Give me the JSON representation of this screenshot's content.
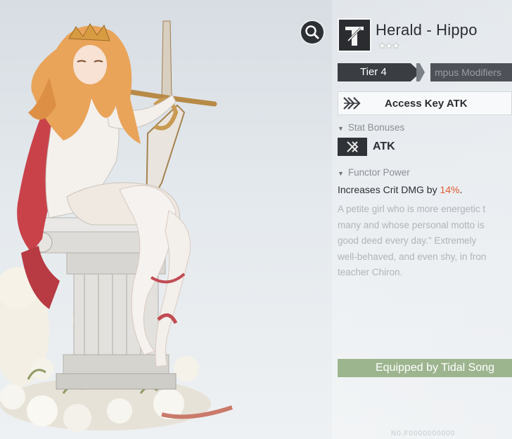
{
  "card": {
    "name": "Herald - Hippo",
    "stars": "★★★",
    "tier": "Tier 4",
    "modifiers_tab": "mpus Modifiers",
    "access_key": "Access Key ATK",
    "stat_heading": "Stat Bonuses",
    "stat_label": "ATK",
    "functor_heading": "Functor Power",
    "power_text": "Increases Crit DMG by ",
    "power_value": "14%",
    "power_suffix": ".",
    "description": [
      "A petite girl who is more energetic t",
      "many and whose personal motto is",
      "good deed every day.\" Extremely",
      "well-behaved, and even shy, in fron",
      "teacher Chiron."
    ],
    "equipped": "Equipped by Tidal Song",
    "serial": "N0.F0000000000"
  },
  "icons": {
    "zoom": "magnifier-icon",
    "card": "sword-emblem-icon",
    "access": "crossed-arrows-icon",
    "atk": "atk-stat-icon"
  },
  "colors": {
    "accent_orange": "#e05a2f",
    "equipped_green": "#9db58f",
    "dark_slate": "#3a3d42"
  }
}
